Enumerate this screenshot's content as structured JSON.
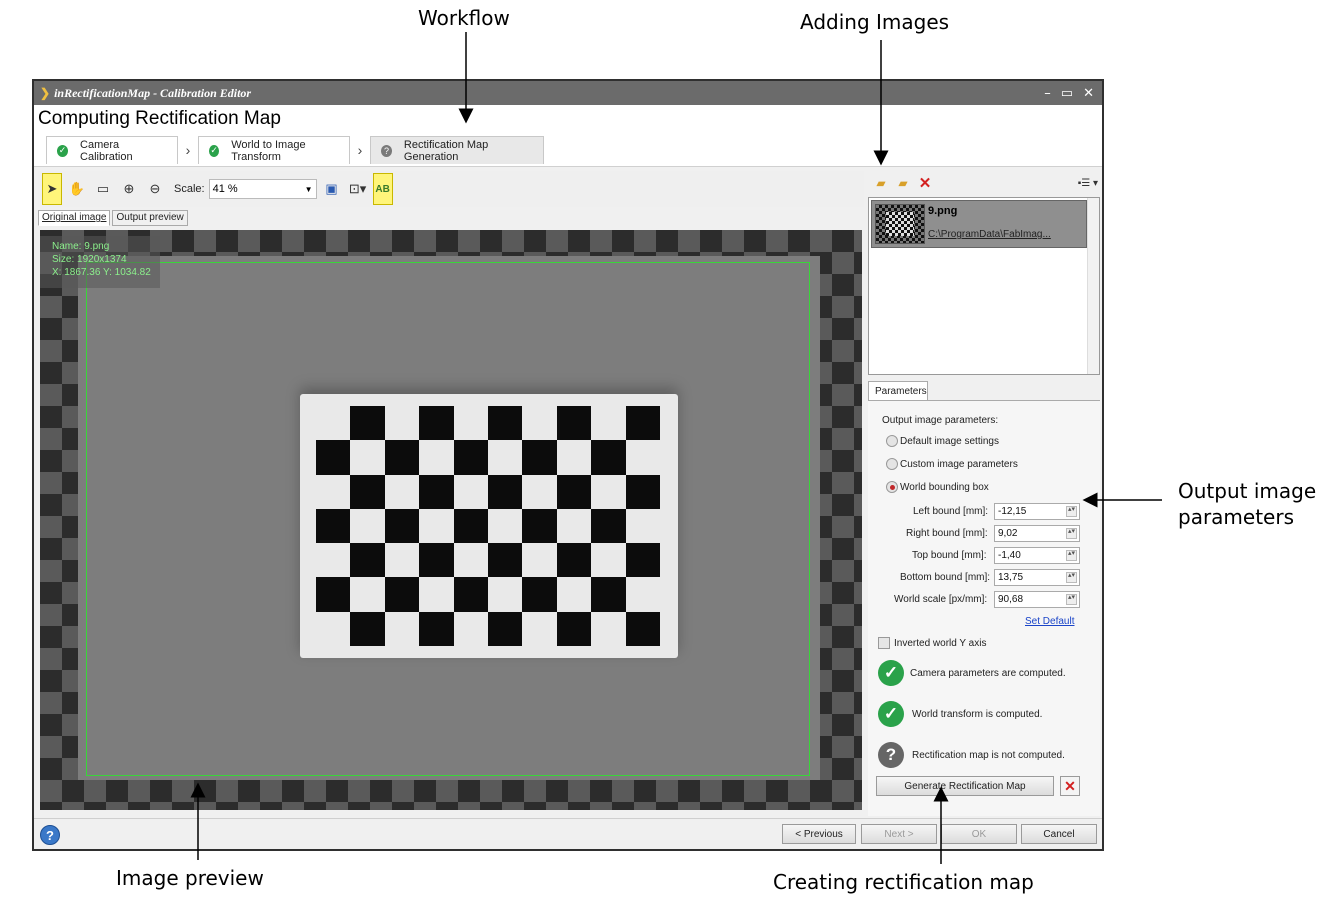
{
  "annotations": {
    "workflow": "Workflow",
    "adding_images": "Adding Images",
    "output_params": "Output image\nparameters",
    "output_params_l1": "Output image",
    "output_params_l2": "parameters",
    "image_preview": "Image preview",
    "creating_map": "Creating rectification map"
  },
  "window": {
    "title": "inRectificationMap - Calibration Editor",
    "controls": [
      "–",
      "▭",
      "✕"
    ]
  },
  "header": {
    "title": "Computing Rectification Map",
    "steps": [
      {
        "label": "Camera Calibration",
        "status": "done"
      },
      {
        "label": "World to Image Transform",
        "status": "done"
      },
      {
        "label": "Rectification Map Generation",
        "status": "current"
      }
    ]
  },
  "toolbar": {
    "scale_label": "Scale:",
    "scale_value": "41 %",
    "ab_label": "AB"
  },
  "view_tabs": [
    "Original image",
    "Output preview"
  ],
  "image_info": {
    "name": "Name: 9.png",
    "size": "Size: 1920x1374",
    "coords": "X: 1867.36 Y: 1034.82"
  },
  "images": [
    {
      "name": "9.png",
      "path": "C:\\ProgramData\\FabImag..."
    }
  ],
  "parameters": {
    "tab": "Parameters",
    "group_label": "Output image parameters:",
    "radio_default": "Default image settings",
    "radio_custom": "Custom image parameters",
    "radio_world": "World bounding box",
    "selected": "World bounding box",
    "left_bound_label": "Left bound [mm]:",
    "left_bound": "-12,15",
    "right_bound_label": "Right bound [mm]:",
    "right_bound": "9,02",
    "top_bound_label": "Top bound [mm]:",
    "top_bound": "-1,40",
    "bottom_bound_label": "Bottom bound [mm]:",
    "bottom_bound": "13,75",
    "world_scale_label": "World scale [px/mm]:",
    "world_scale": "90,68",
    "set_default": "Set Default",
    "inverted_y": "Inverted world Y axis",
    "status_camera": "Camera parameters are computed.",
    "status_world": "World transform is computed.",
    "status_map": "Rectification map is not computed.",
    "generate_button": "Generate Rectification Map"
  },
  "footer": {
    "previous": "< Previous",
    "next": "Next >",
    "ok": "OK",
    "cancel": "Cancel"
  },
  "colors": {
    "roi": "#39d639",
    "ok_green": "#2aa24a",
    "highlight": "#fff57a"
  }
}
